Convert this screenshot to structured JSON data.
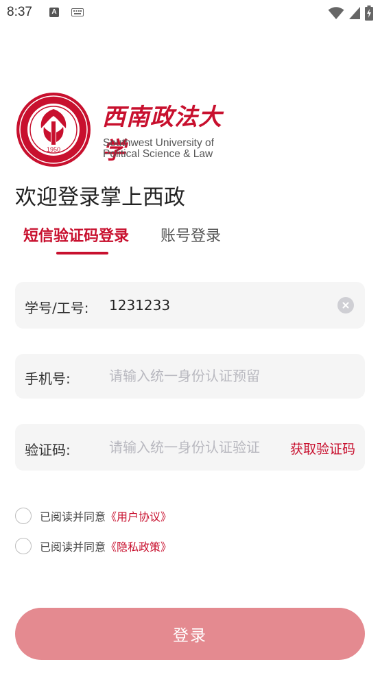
{
  "status_bar": {
    "time": "8:37",
    "a_badge": "A",
    "icons": [
      "keyboard-icon",
      "wifi-icon",
      "cellular-icon",
      "battery-charging-icon"
    ]
  },
  "logo": {
    "name_cn": "西南政法大学",
    "name_en_line1": "Southwest University of",
    "name_en_line2": "Political Science & Law",
    "seal_year": "1950"
  },
  "welcome_title": "欢迎登录掌上西政",
  "tabs": [
    {
      "label": "短信验证码登录",
      "active": true
    },
    {
      "label": "账号登录",
      "active": false
    }
  ],
  "form": {
    "id_label": "学号/工号:",
    "id_value": "1231233",
    "phone_label": "手机号:",
    "phone_placeholder": "请输入统一身份认证预留",
    "code_label": "验证码:",
    "code_placeholder": "请输入统一身份认证验证",
    "get_code_label": "获取验证码"
  },
  "agreements": [
    {
      "text": "已阅读并同意",
      "link": "《用户协议》"
    },
    {
      "text": "已阅读并同意",
      "link": "《隐私政策》"
    }
  ],
  "login_button": "登录",
  "colors": {
    "accent": "#c8102e",
    "button": "#e48a90",
    "field_bg": "#f5f5f5"
  }
}
